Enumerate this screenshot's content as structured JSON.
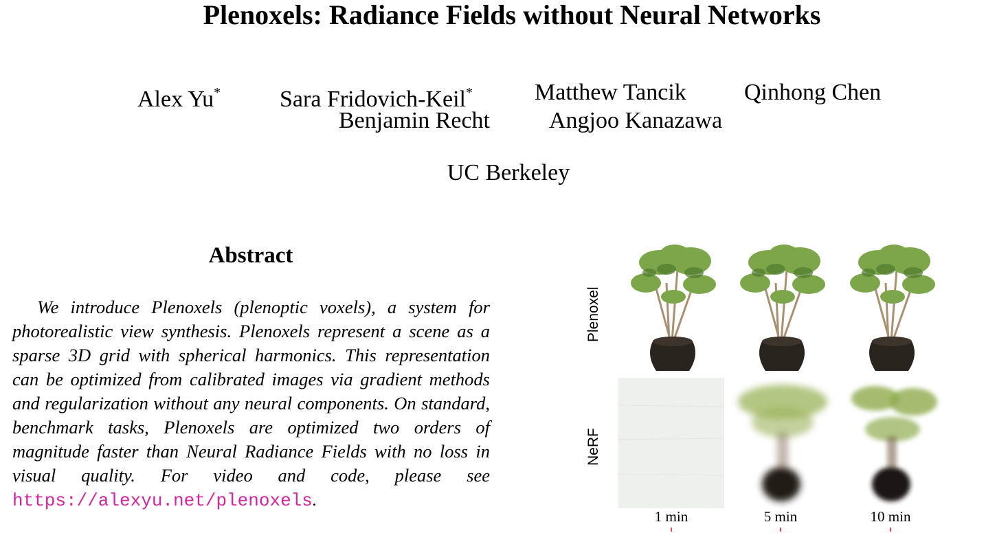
{
  "title": "Plenoxels: Radiance Fields without Neural Networks",
  "authors": [
    {
      "name": "Alex Yu",
      "mark": "*"
    },
    {
      "name": "Sara Fridovich-Keil",
      "mark": "*"
    },
    {
      "name": "Matthew Tancik",
      "mark": ""
    },
    {
      "name": "Qinhong Chen",
      "mark": ""
    },
    {
      "name": "Benjamin Recht",
      "mark": ""
    },
    {
      "name": "Angjoo Kanazawa",
      "mark": ""
    }
  ],
  "affiliation": "UC Berkeley",
  "abstract": {
    "heading": "Abstract",
    "text": "We introduce Plenoxels (plenoptic voxels), a system for photorealistic view synthesis. Plenoxels represent a scene as a sparse 3D grid with spherical harmonics. This representa­tion can be optimized from calibrated images via gradient methods and regularization without any neural components. On standard, benchmark tasks, Plenoxels are optimized two orders of magnitude faster than Neural Radiance Fields with no loss in visual quality. For video and code, please see ",
    "link": "https://alexyu.net/plenoxels",
    "end": "."
  },
  "figure": {
    "row_labels": [
      "Plenoxel",
      "NeRF"
    ],
    "columns": [
      "1 min",
      "5 min",
      "10 min"
    ],
    "colors": {
      "leaf": "#7da64a",
      "leaf_dark": "#4f7a2c",
      "stem": "#a89070",
      "pot": "#2a241e",
      "nerf_blur": "#9bb35a",
      "link": "#d4249e"
    }
  }
}
